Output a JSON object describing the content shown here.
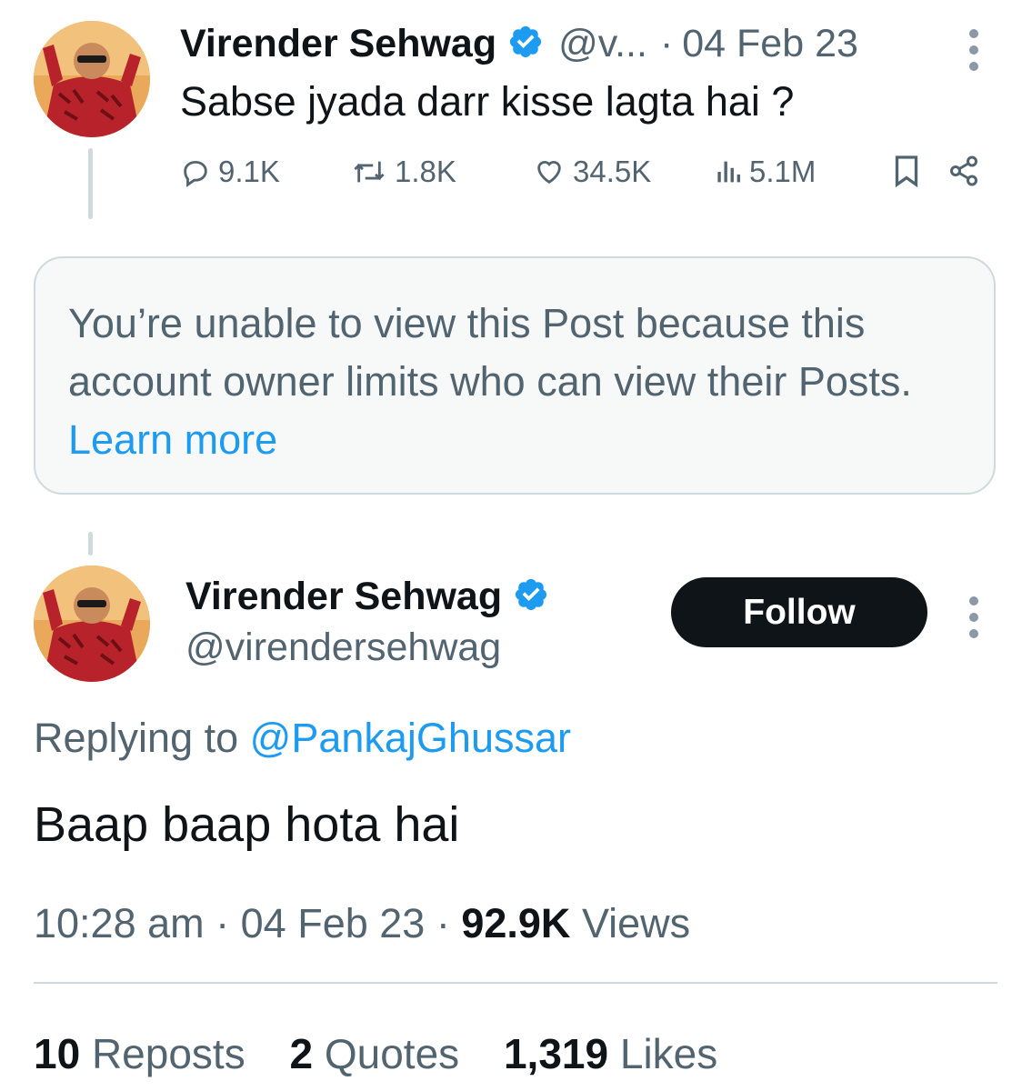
{
  "parent_post": {
    "author_name": "Virender Sehwag",
    "handle_truncated": "@v...",
    "separator": "·",
    "date": "04 Feb 23",
    "text": "Sabse jyada darr kisse lagta hai ?",
    "actions": {
      "replies": "9.1K",
      "reposts": "1.8K",
      "likes": "34.5K",
      "views": "5.1M"
    }
  },
  "restricted_notice": {
    "text": "You’re unable to view this Post because this account owner limits who can view their Posts.",
    "link_text": "Learn more"
  },
  "main_post": {
    "author_name": "Virender Sehwag",
    "handle": "@virendersehwag",
    "follow_label": "Follow",
    "replying_prefix": "Replying to",
    "replying_to": "@PankajGhussar",
    "text": "Baap baap hota hai",
    "time": "10:28 am",
    "separator": "·",
    "date": "04 Feb 23",
    "views_count": "92.9K",
    "views_label": "Views",
    "stats": {
      "reposts_count": "10",
      "reposts_label": "Reposts",
      "quotes_count": "2",
      "quotes_label": "Quotes",
      "likes_count": "1,319",
      "likes_label": "Likes"
    }
  },
  "colors": {
    "text": "#0f1419",
    "muted": "#536471",
    "link": "#1d9bf0",
    "verified": "#1d9bf0",
    "border": "#cfd9de",
    "box_bg": "#f7f9f9"
  },
  "icons": [
    "reply-icon",
    "repost-icon",
    "like-icon",
    "views-icon",
    "bookmark-icon",
    "share-icon",
    "verified-badge-icon",
    "more-options-icon"
  ]
}
